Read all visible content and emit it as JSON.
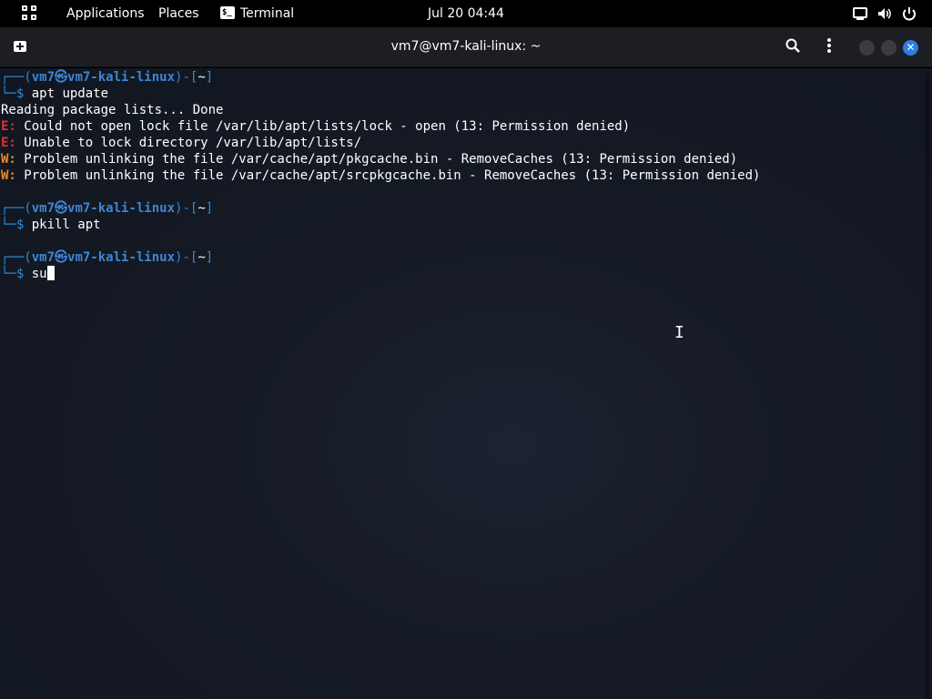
{
  "top_panel": {
    "applications_label": "Applications",
    "places_label": "Places",
    "terminal_label": "Terminal",
    "terminal_icon_glyph": "$_",
    "clock": "Jul 20  04:44"
  },
  "window": {
    "title": "vm7@vm7-kali-linux: ~"
  },
  "terminal": {
    "prompt": {
      "top_prefix": "┌──(",
      "user": "vm7",
      "at_symbol": "㉿",
      "host": "vm7-kali-linux",
      "dir_open": ")-[",
      "dir": "~",
      "dir_close": "]",
      "bottom_prefix": "└─",
      "dollar": "$"
    },
    "commands": [
      "apt update",
      "pkill apt",
      "su"
    ],
    "output": {
      "line1": "Reading package lists... Done",
      "e_tag": "E:",
      "w_tag": "W:",
      "err1": " Could not open lock file /var/lib/apt/lists/lock - open (13: Permission denied)",
      "err2": " Unable to lock directory /var/lib/apt/lists/",
      "warn1": " Problem unlinking the file /var/cache/apt/pkgcache.bin - RemoveCaches (13: Permission denied)",
      "warn2": " Problem unlinking the file /var/cache/apt/srcpkgcache.bin - RemoveCaches (13: Permission denied)"
    }
  }
}
